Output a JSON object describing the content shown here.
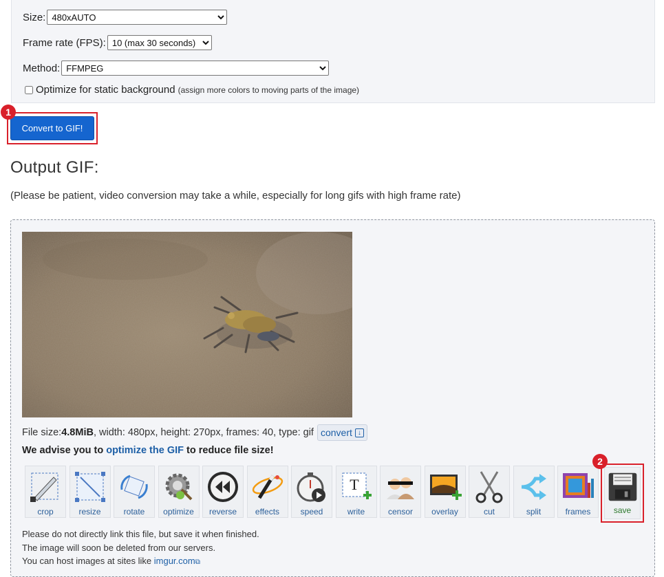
{
  "options": {
    "size_label": "Size:",
    "size_value": "480xAUTO",
    "fps_label": "Frame rate (FPS):",
    "fps_value": "10 (max 30 seconds)",
    "method_label": "Method:",
    "method_value": "FFMPEG",
    "optimize_label": "Optimize for static background",
    "optimize_note": "(assign more colors to moving parts of the image)"
  },
  "convert_button": "Convert to GIF!",
  "badges": {
    "one": "1",
    "two": "2"
  },
  "output": {
    "title": "Output GIF:",
    "note": "(Please be patient, video conversion may take a while, especially for long gifs with high frame rate)",
    "info_prefix": "File size: ",
    "file_size": "4.8MiB",
    "info_rest": ", width: 480px, height: 270px, frames: 40, type: gif",
    "convert_link": "convert",
    "advise_a": "We advise you to ",
    "advise_link": "optimize the GIF",
    "advise_b": " to reduce file size!"
  },
  "tools": [
    "crop",
    "resize",
    "rotate",
    "optimize",
    "reverse",
    "effects",
    "speed",
    "write",
    "censor",
    "overlay",
    "cut",
    "split",
    "frames",
    "save"
  ],
  "footer": {
    "line1": "Please do not directly link this file, but save it when finished.",
    "line2": "The image will soon be deleted from our servers.",
    "line3_prefix": "You can host images at sites like ",
    "line3_link": "imgur.com"
  }
}
